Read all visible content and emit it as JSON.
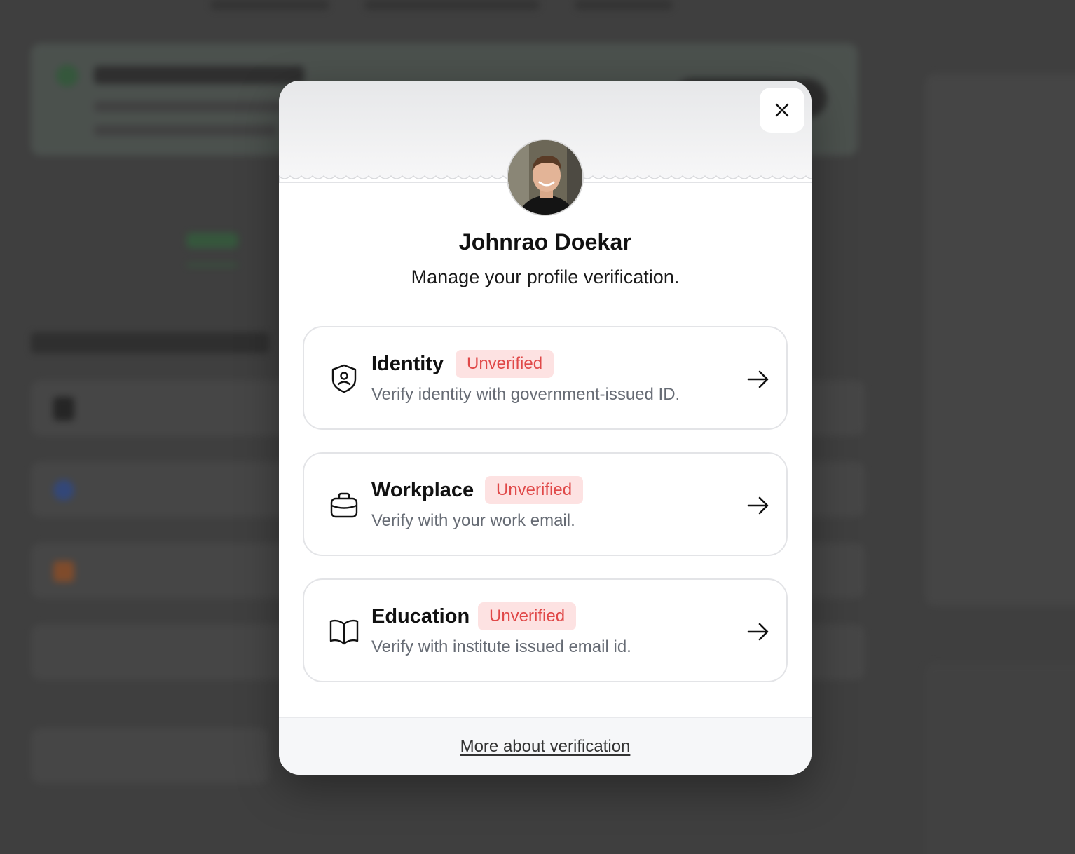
{
  "modal": {
    "close_icon": "close-icon",
    "profile": {
      "name": "Johnrao Doekar",
      "subtitle": "Manage your profile verification."
    },
    "verifications": [
      {
        "title": "Identity",
        "status": "Unverified",
        "description": "Verify identity with government-issued ID.",
        "icon": "shield-user-icon"
      },
      {
        "title": "Workplace",
        "status": "Unverified",
        "description": "Verify with your work email.",
        "icon": "briefcase-icon"
      },
      {
        "title": "Education",
        "status": "Unverified",
        "description": "Verify with institute issued email id.",
        "icon": "book-open-icon"
      }
    ],
    "footer_link": "More about verification"
  },
  "colors": {
    "badge_bg": "#fde2e2",
    "badge_text": "#e04848",
    "overlay": "#3f3f3f"
  }
}
